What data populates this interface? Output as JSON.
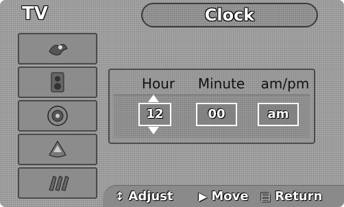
{
  "header": {
    "source_label": "TV",
    "menu_title": "Clock"
  },
  "sidebar": {
    "items": [
      {
        "icon": "picture-icon"
      },
      {
        "icon": "sound-icon"
      },
      {
        "icon": "channel-icon"
      },
      {
        "icon": "setup-icon"
      },
      {
        "icon": "input-icon"
      }
    ]
  },
  "clock": {
    "headers": {
      "hour": "Hour",
      "minute": "Minute",
      "ampm": "am/pm"
    },
    "hour_value": "12",
    "minute_value": "00",
    "ampm_value": "am",
    "selected_field": "hour"
  },
  "footer": {
    "adjust_icon": "updown-arrow-icon",
    "adjust_label": "Adjust",
    "move_icon": "right-arrow-icon",
    "move_label": "Move",
    "return_icon": "menu-icon",
    "return_label": "Return"
  },
  "colors": {
    "osd_background": "#a6a6a6",
    "text": "#ffffff",
    "outline": "#000000"
  }
}
